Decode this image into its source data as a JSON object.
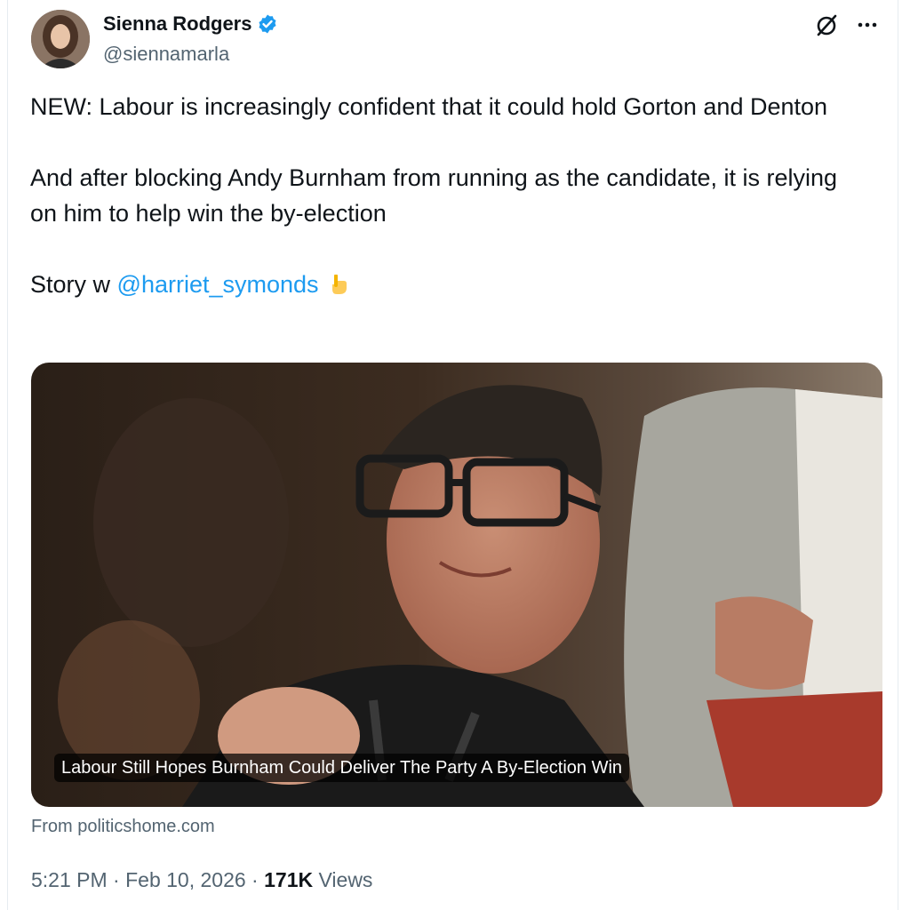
{
  "author": {
    "name": "Sienna Rodgers",
    "handle": "@siennamarla"
  },
  "icons": {
    "verified": "verified-badge-icon",
    "grok": "grok-icon",
    "more": "more-options-icon",
    "emoji": "backhand-index-pointing-down-emoji"
  },
  "tweet": {
    "line1": "NEW: Labour is increasingly confident that it could hold Gorton and Denton",
    "line2": "And after blocking Andy Burnham from running as the candidate, it is relying on him to help win the by-election",
    "line3_prefix": "Story w ",
    "mention": "@harriet_symonds"
  },
  "card": {
    "headline": "Labour Still Hopes Burnham Could Deliver The Party A By-Election Win",
    "source": "From politicshome.com"
  },
  "meta": {
    "time": "5:21 PM",
    "separator1": " · ",
    "date": "Feb 10, 2026",
    "separator2": " · ",
    "views_count": "171K",
    "views_label": " Views"
  },
  "colors": {
    "link": "#1d9bf0",
    "secondary_text": "#536471",
    "primary_text": "#0f1419",
    "verified": "#1d9bf0"
  }
}
